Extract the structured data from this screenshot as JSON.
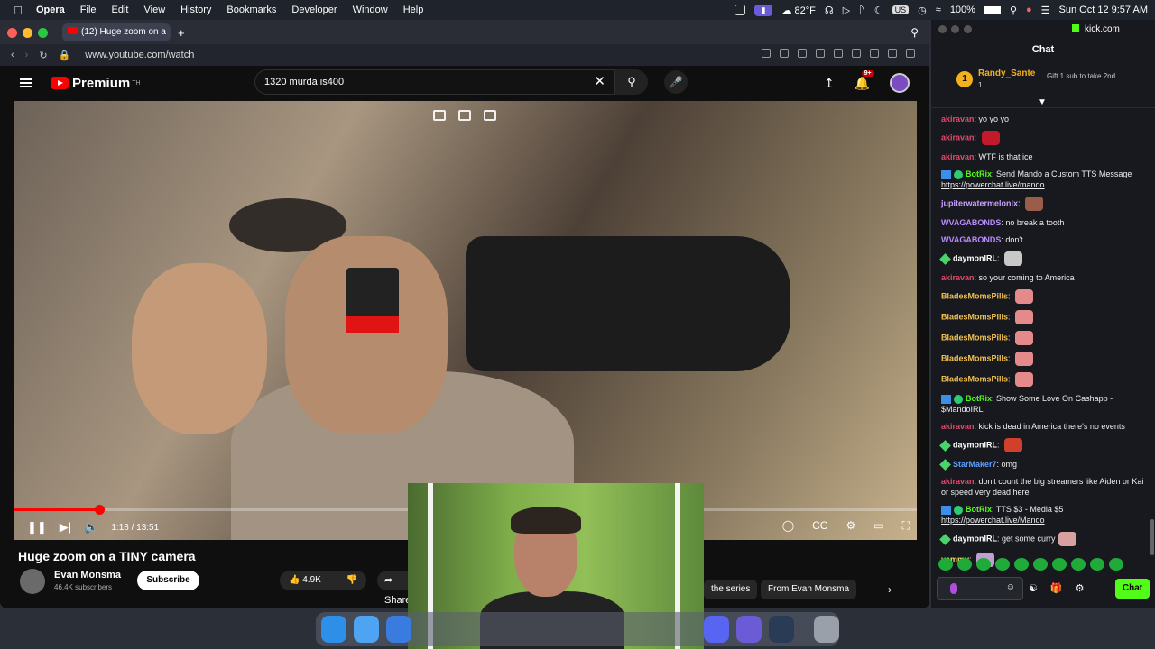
{
  "menubar": {
    "app": "Opera",
    "items": [
      "File",
      "Edit",
      "View",
      "History",
      "Bookmarks",
      "Developer",
      "Window",
      "Help"
    ],
    "weather": "82°F",
    "input_lang": "US",
    "battery": "100%",
    "datetime": "Sun Oct 12  9:57 AM"
  },
  "browser": {
    "tab_title": "(12) Huge zoom on a",
    "url": "www.youtube.com/watch"
  },
  "youtube": {
    "brand": "Premium",
    "brand_sup": "TH",
    "search_value": "1320 murda is400",
    "notification_count": "9+"
  },
  "video": {
    "time": "1:18 / 13:51",
    "progress_fraction": 0.094
  },
  "meta": {
    "title": "Huge zoom on a TINY camera",
    "channel": "Evan Monsma",
    "subscribers": "46.4K subscribers",
    "subscribe_label": "Subscribe",
    "likes": "4.9K",
    "share_label": "Share",
    "chips": [
      "the series",
      "From Evan Monsma"
    ]
  },
  "chat": {
    "domain": "kick.com",
    "title": "Chat",
    "gifter": {
      "name": "Randy_Sante",
      "rank": "1",
      "count": "1",
      "gift_text": "Gift 1 sub to take 2nd"
    },
    "messages": [
      {
        "user": "akiravan",
        "color": "#e14a6b",
        "text": "yo yo yo"
      },
      {
        "user": "akiravan",
        "color": "#e14a6b",
        "text": "",
        "emote": "#c21a2a"
      },
      {
        "user": "akiravan",
        "color": "#e14a6b",
        "text": "WTF is that ice"
      },
      {
        "user": "BotRix",
        "color": "#53fc18",
        "badge": "bot",
        "text": "Send Mando a Custom TTS Message ",
        "link": "https://powerchat.live/mando"
      },
      {
        "user": "jupiterwatermelonix",
        "color": "#c8a0ff",
        "text": "",
        "emote": "#9a5d4a"
      },
      {
        "user": "WVAGABONDS",
        "color": "#b98cff",
        "text": "no break a tooth"
      },
      {
        "user": "WVAGABONDS",
        "color": "#b98cff",
        "text": "don't"
      },
      {
        "user": "daymonIRL",
        "color": "#ffffff",
        "badge": "gem",
        "text": "",
        "emote": "#c8c8c8"
      },
      {
        "user": "akiravan",
        "color": "#e14a6b",
        "text": "so your coming to America"
      },
      {
        "user": "BladesMomsPills",
        "color": "#f0c050",
        "text": "",
        "emote": "#e58a8a"
      },
      {
        "user": "BladesMomsPills",
        "color": "#f0c050",
        "text": "",
        "emote": "#e58a8a"
      },
      {
        "user": "BladesMomsPills",
        "color": "#f0c050",
        "text": "",
        "emote": "#e58a8a"
      },
      {
        "user": "BladesMomsPills",
        "color": "#f0c050",
        "text": "",
        "emote": "#e58a8a"
      },
      {
        "user": "BladesMomsPills",
        "color": "#f0c050",
        "text": "",
        "emote": "#e58a8a"
      },
      {
        "user": "BotRix",
        "color": "#53fc18",
        "badge": "bot",
        "text": "Show Some Love On Cashapp - $MandoIRL"
      },
      {
        "user": "akiravan",
        "color": "#e14a6b",
        "text": "kick is dead in America there's no events"
      },
      {
        "user": "daymonIRL",
        "color": "#ffffff",
        "badge": "gem",
        "text": "",
        "emote": "#d0402a"
      },
      {
        "user": "StarMaker7",
        "color": "#5aa0ff",
        "badge": "gem",
        "text": "omg"
      },
      {
        "user": "akiravan",
        "color": "#e14a6b",
        "text": "don't count the big streamers like Aiden or Kai or speed very dead here"
      },
      {
        "user": "BotRix",
        "color": "#53fc18",
        "badge": "bot",
        "text": "TTS $3 - Media $5 ",
        "link": "https://powerchat.live/Mando"
      },
      {
        "user": "daymonIRL",
        "color": "#ffffff",
        "badge": "gem",
        "text": "get some curry",
        "emote": "#d9a0a0"
      },
      {
        "user": "yammy",
        "color": "#f0e060",
        "text": "",
        "emote": "#c0a0d0"
      }
    ],
    "send_label": "Chat"
  },
  "colors": {
    "accent_kick": "#53fc18",
    "youtube_red": "#ff0000",
    "opera_purple": "#6b5bd6"
  }
}
